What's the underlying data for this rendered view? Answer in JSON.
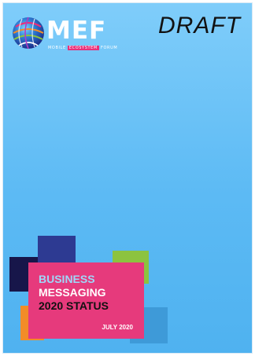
{
  "logo": {
    "wordmark": "MEF",
    "tagline_part1": "MOBILE ",
    "tagline_highlight": "ECOSYSTEM",
    "tagline_part2": " FORUM"
  },
  "watermark": "DRAFT",
  "title": {
    "line1": "BUSINESS",
    "line2": "MESSAGING",
    "line3": "2020 STATUS"
  },
  "date": "JULY 2020",
  "colors": {
    "background": "#6cc4f7",
    "title_box": "#e63a7c",
    "navy": "#17164a",
    "indigo": "#2d3a92",
    "green": "#8cc33f",
    "orange": "#f28c28",
    "light_blue": "#3e9ad8"
  }
}
